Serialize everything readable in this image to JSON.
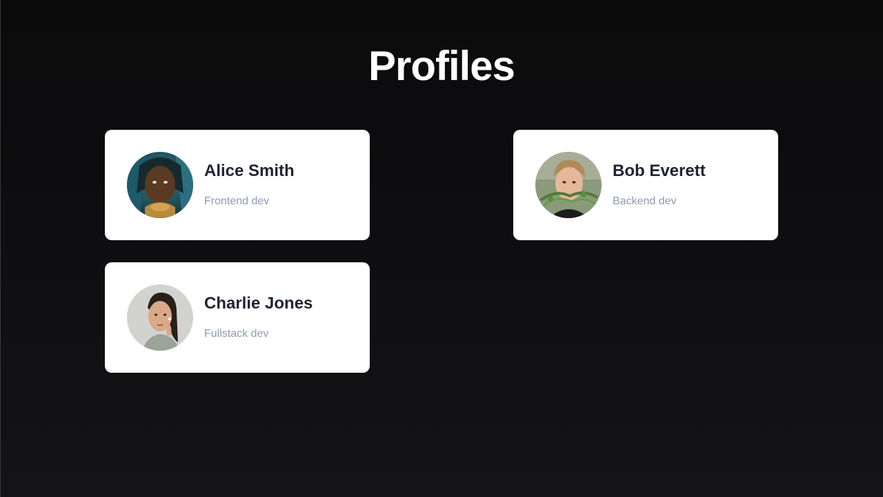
{
  "page": {
    "title": "Profiles",
    "background": "#0d0d0f"
  },
  "profiles": [
    {
      "name": "Alice Smith",
      "role": "Frontend dev",
      "avatar_icon": "person-avatar-icon"
    },
    {
      "name": "Bob Everett",
      "role": "Backend dev",
      "avatar_icon": "person-avatar-icon"
    },
    {
      "name": "Charlie Jones",
      "role": "Fullstack dev",
      "avatar_icon": "person-avatar-icon"
    }
  ],
  "colors": {
    "card": "#ffffff",
    "name_text": "#1f2433",
    "role_text": "#8d9aad",
    "title_text": "#ffffff"
  }
}
